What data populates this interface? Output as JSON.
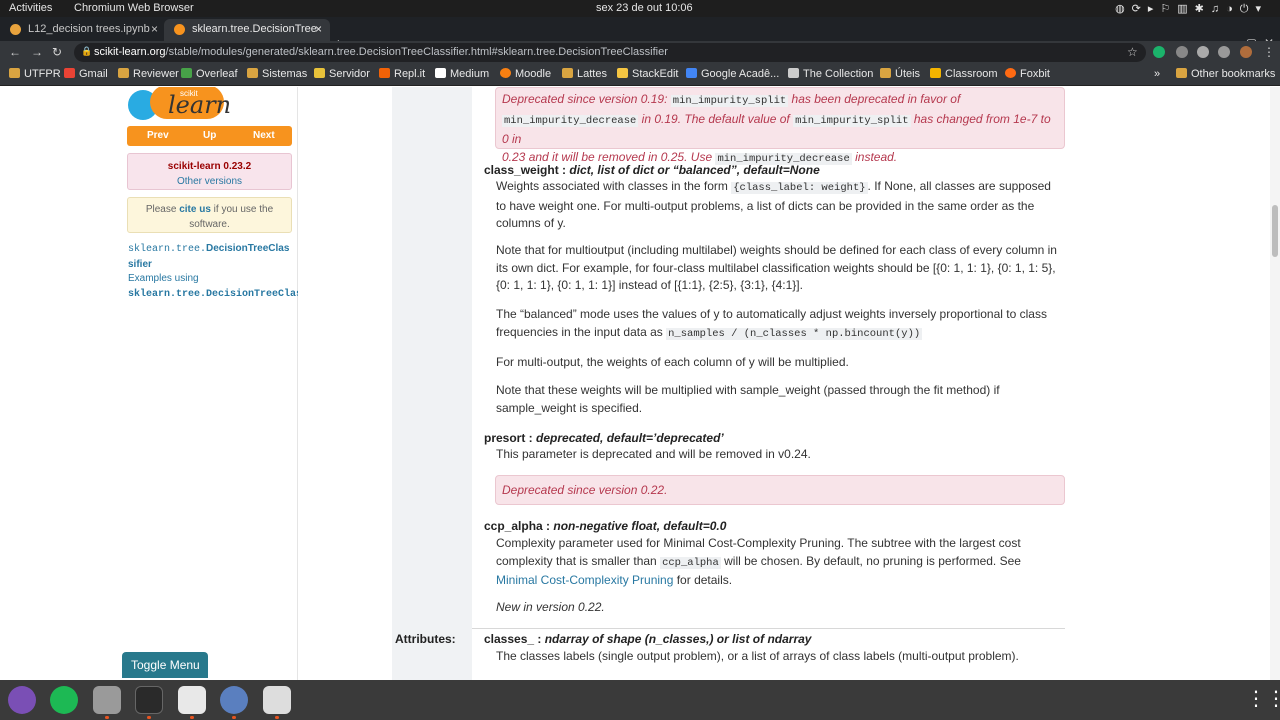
{
  "system": {
    "activities": "Activities",
    "app": "Chromium Web Browser",
    "clock": "sex 23 de out  10:06"
  },
  "tabs": [
    {
      "label": "L12_decision trees.ipynb"
    },
    {
      "label": "sklearn.tree.DecisionTree"
    }
  ],
  "address": {
    "host": "scikit-learn.org",
    "path": "/stable/modules/generated/sklearn.tree.DecisionTreeClassifier.html#sklearn.tree.DecisionTreeClassifier"
  },
  "bookmarks": [
    "UTFPR",
    "Gmail",
    "Reviewer",
    "Overleaf",
    "Sistemas",
    "Servidor",
    "Repl.it",
    "Medium",
    "Moodle",
    "Lattes",
    "StackEdit",
    "Google Acadê...",
    "The Collection",
    "Úteis",
    "Classroom",
    "Foxbit"
  ],
  "other_bookmarks": "Other bookmarks",
  "sidebar": {
    "logo_small": "scikit",
    "logo_big": "learn",
    "prev": "Prev",
    "up": "Up",
    "next": "Next",
    "version": "scikit-learn 0.23.2",
    "other_versions": "Other versions",
    "cite_pre": "Please ",
    "cite_link": "cite us",
    "cite_post": " if you use the software.",
    "nav1": "sklearn.tree.",
    "nav1b": "DecisionTreeClas",
    "nav1c": "sifier",
    "nav2": "Examples using",
    "nav3": "sklearn.tree.DecisionTreeClass",
    "toggle": "Toggle Menu"
  },
  "doc": {
    "dep1_a": "Deprecated since version 0.19: ",
    "dep1_c1": "min_impurity_split",
    "dep1_b": " has been deprecated in favor of",
    "dep1_c2": "min_impurity_decrease",
    "dep1_d": " in 0.19. The default value of ",
    "dep1_c3": "min_impurity_split",
    "dep1_e": " has changed from 1e-7 to 0 in",
    "dep1_f": "0.23 and it will be removed in 0.25. Use ",
    "dep1_c4": "min_impurity_decrease",
    "dep1_g": " instead.",
    "cw_name": "class_weight : ",
    "cw_type": "dict, list of dict or “balanced”, default=None",
    "cw_p1a": "Weights associated with classes in the form ",
    "cw_p1code": "{class_label: weight}",
    "cw_p1b": ". If None, all classes are supposed to have weight one. For multi-output problems, a list of dicts can be provided in the same order as the columns of y.",
    "cw_p2": "Note that for multioutput (including multilabel) weights should be defined for each class of every column in its own dict. For example, for four-class multilabel classification weights should be [{0: 1, 1: 1}, {0: 1, 1: 5}, {0: 1, 1: 1}, {0: 1, 1: 1}] instead of [{1:1}, {2:5}, {3:1}, {4:1}].",
    "cw_p3a": "The “balanced” mode uses the values of y to automatically adjust weights inversely proportional to class frequencies in the input data as ",
    "cw_p3code": "n_samples / (n_classes * np.bincount(y))",
    "cw_p4": "For multi-output, the weights of each column of y will be multiplied.",
    "cw_p5": "Note that these weights will be multiplied with sample_weight (passed through the fit method) if sample_weight is specified.",
    "pre_name": "presort : ",
    "pre_type": "deprecated, default=’deprecated’",
    "pre_p": "This parameter is deprecated and will be removed in v0.24.",
    "dep2": "Deprecated since version 0.22.",
    "ccp_name": "ccp_alpha : ",
    "ccp_type": "non-negative float, default=0.0",
    "ccp_pa": "Complexity parameter used for Minimal Cost-Complexity Pruning. The subtree with the largest cost complexity that is smaller than ",
    "ccp_code": "ccp_alpha",
    "ccp_pb": " will be chosen. By default, no pruning is performed. See ",
    "ccp_link": "Minimal Cost-Complexity Pruning",
    "ccp_pc": " for details.",
    "ccp_new": "New in version 0.22.",
    "attr_label": "Attributes:",
    "cls_name": "classes_ : ",
    "cls_type": "ndarray of shape (n_classes,) or list of ndarray",
    "cls_p": "The classes labels (single output problem), or a list of arrays of class labels (multi-output problem)."
  }
}
